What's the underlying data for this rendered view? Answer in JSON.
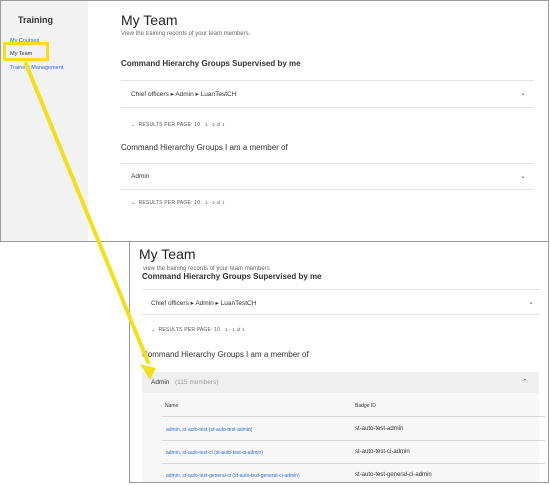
{
  "back": {
    "sidebar": {
      "title": "Training",
      "items": [
        {
          "label": "My Courses"
        },
        {
          "label": "My Team"
        },
        {
          "label": "Training Management"
        }
      ]
    },
    "title": "My Team",
    "subtitle": "View the training records of your team members.",
    "supervised_heading": "Command Hierarchy Groups Supervised by me",
    "supervised_row": "Chief officers  ▸  Admin  ▸  LuanTestCH",
    "results_label": "RESULTS PER PAGE: 10",
    "results_range": "1 - 1 of 1",
    "member_heading": "Command Hierarchy Groups I am a member of",
    "member_row": "Admin",
    "results2_label": "RESULTS PER PAGE: 10",
    "results2_range": "1 - 1 of 1"
  },
  "front": {
    "title": "My Team",
    "subtitle": "view the training records of your team members",
    "supervised_heading": "Command Hierarchy Groups Supervised by me",
    "supervised_row": "Chief officers  ▸  Admin  ▸  LuanTestCH",
    "results_label": "RESULTS PER PAGE: 10",
    "results_range": "1 - 1 of 1",
    "member_heading": "Command Hierarchy Groups I am a member of",
    "admin_label": "Admin",
    "admin_count": "(115 members)",
    "table": {
      "headers": {
        "name": "Name",
        "badge": "Badge ID"
      },
      "rows": [
        {
          "name": "admin, st-auto-test (st-auto-test-admin)",
          "badge": "st-auto-test-admin"
        },
        {
          "name": "admin, st-auto-test-ci (st-auto-test-ci-admin)",
          "badge": "st-auto-test-ci-admin"
        },
        {
          "name": "admin, st-auto-test-general-ci (st-auto-test-general-ci-admin)",
          "badge": "st-auto-test-general-ci-admin"
        }
      ]
    }
  },
  "colors": {
    "highlight": "#f2e01a",
    "link": "#2f6fcf",
    "admin_bar": "#efefef"
  }
}
